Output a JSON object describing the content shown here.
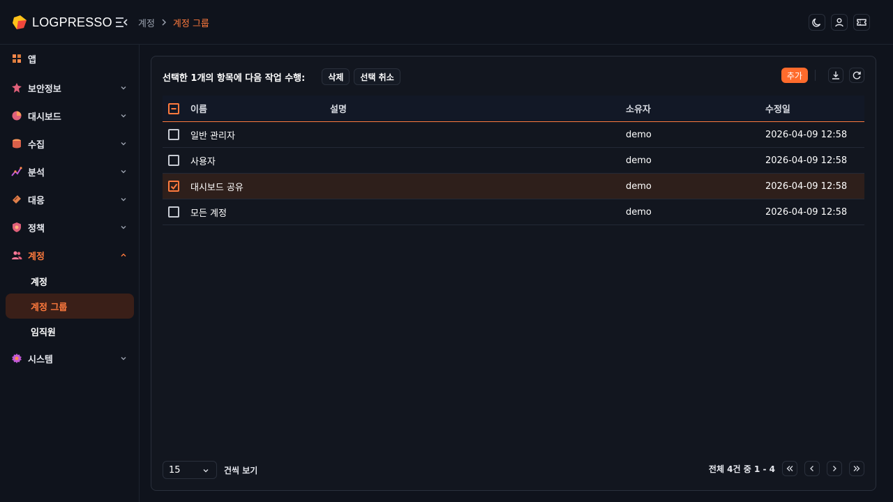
{
  "brand": {
    "name": "LOGPRESSO",
    "colors": {
      "accent": "#ff7a3d",
      "add_button": "#ff6b2c",
      "logo_yellow": "#ffc21a",
      "logo_red": "#f0463c"
    }
  },
  "header": {
    "breadcrumb": [
      "계정",
      "계정 그룹"
    ],
    "icons": [
      "moon-icon",
      "user-icon",
      "ticket-icon"
    ]
  },
  "sidebar": {
    "items": [
      {
        "label": "앱",
        "icon": "apps-icon",
        "expandable": false
      },
      {
        "label": "보안정보",
        "icon": "security-info-icon",
        "expandable": true
      },
      {
        "label": "대시보드",
        "icon": "dashboard-icon",
        "expandable": true
      },
      {
        "label": "수집",
        "icon": "collect-icon",
        "expandable": true
      },
      {
        "label": "분석",
        "icon": "analysis-icon",
        "expandable": true
      },
      {
        "label": "대응",
        "icon": "response-icon",
        "expandable": true
      },
      {
        "label": "정책",
        "icon": "policy-icon",
        "expandable": true
      },
      {
        "label": "계정",
        "icon": "users-icon",
        "expandable": true,
        "expanded": true
      },
      {
        "label": "시스템",
        "icon": "system-icon",
        "expandable": true
      }
    ],
    "sub_items": [
      "계정",
      "계정 그룹",
      "임직원"
    ],
    "selected_sub": "계정 그룹"
  },
  "toolbar": {
    "selection_text": "선택한 1개의 항목에 다음 작업 수행:",
    "delete_label": "삭제",
    "deselect_label": "선택 취소",
    "add_label": "추가"
  },
  "table": {
    "columns": [
      "이름",
      "설명",
      "소유자",
      "수정일"
    ],
    "rows": [
      {
        "name": "일반 관리자",
        "description": "",
        "owner": "demo",
        "modified": "2026-04-09 12:58",
        "checked": false
      },
      {
        "name": "사용자",
        "description": "",
        "owner": "demo",
        "modified": "2026-04-09 12:58",
        "checked": false
      },
      {
        "name": "대시보드 공유",
        "description": "",
        "owner": "demo",
        "modified": "2026-04-09 12:58",
        "checked": true
      },
      {
        "name": "모든 계정",
        "description": "",
        "owner": "demo",
        "modified": "2026-04-09 12:58",
        "checked": false
      }
    ]
  },
  "footer": {
    "page_size": "15",
    "per_page_label": "건씩 보기",
    "range_text": "전체 4건 중 1 - 4"
  }
}
